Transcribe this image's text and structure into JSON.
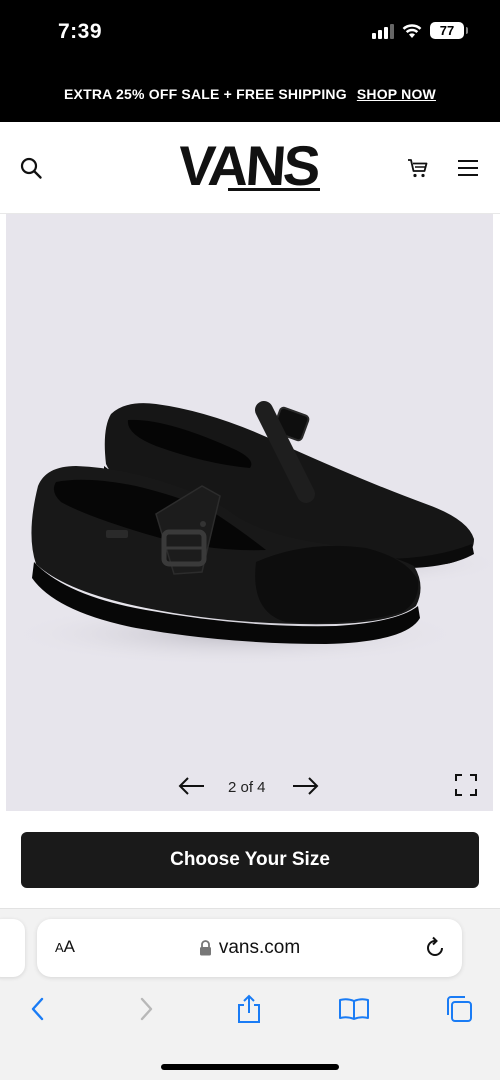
{
  "status_bar": {
    "time": "7:39",
    "battery": "77"
  },
  "promo": {
    "text": "EXTRA 25% OFF SALE + FREE SHIPPING",
    "link": "SHOP NOW"
  },
  "header": {
    "logo_text": "VANS",
    "icons": [
      "search-icon",
      "cart-icon",
      "menu-icon"
    ]
  },
  "gallery": {
    "counter": "2 of 4",
    "current_index": 2,
    "total": 4
  },
  "cta": {
    "label": "Choose Your Size"
  },
  "browser": {
    "text_size_label": "AA",
    "url": "vans.com"
  },
  "colors": {
    "promo_bg": "#000000",
    "cta_bg": "#1a1a1a",
    "gallery_bg": "#e7e5ec",
    "ios_blue": "#1a7cf5"
  }
}
